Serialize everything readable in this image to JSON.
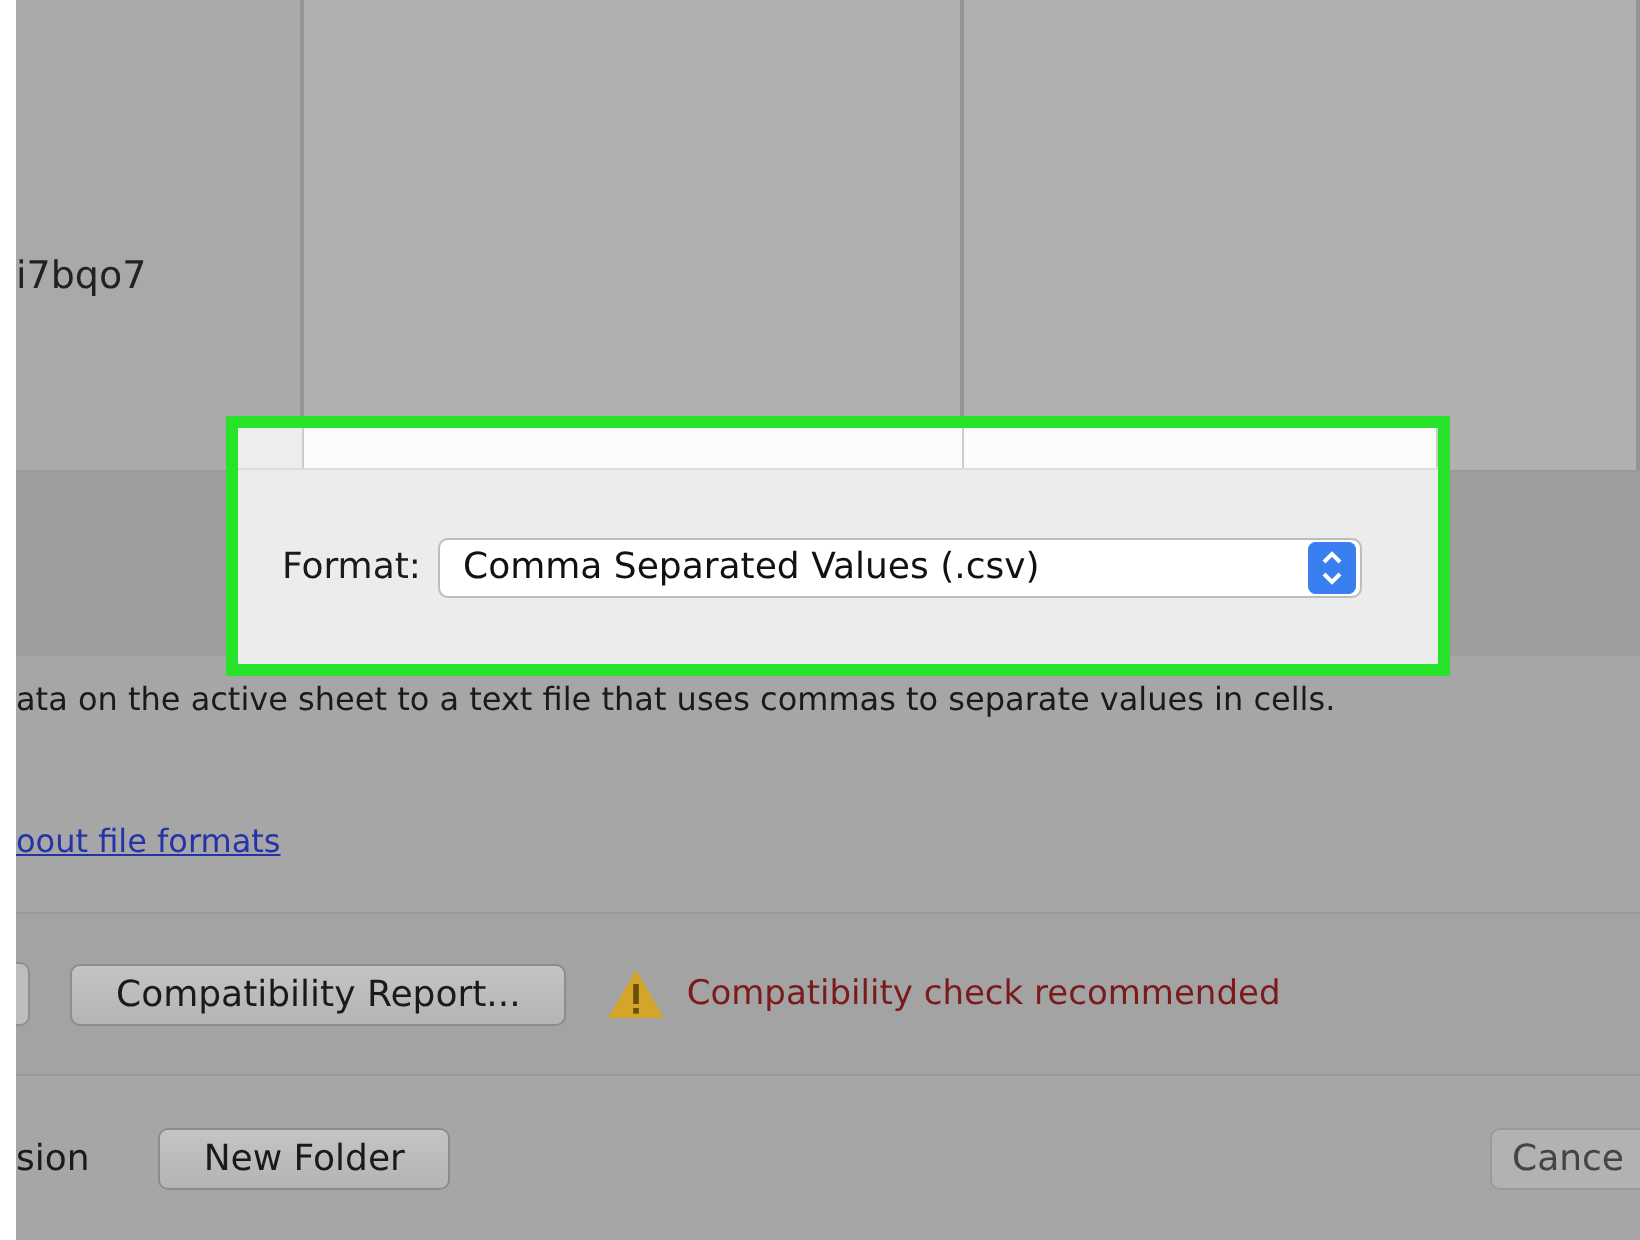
{
  "file_browser": {
    "filename": "i7bqo7"
  },
  "format": {
    "label": "Format:",
    "value": "Comma Separated Values (.csv)"
  },
  "description": "ata on the active sheet to a text file that uses commas to separate values in cells.",
  "link": "oout file formats",
  "compatibility": {
    "button": "Compatibility Report...",
    "warning": "Compatibility check recommended"
  },
  "bottom_bar": {
    "label": "sion",
    "new_folder": "New Folder",
    "cancel": "Cance"
  }
}
